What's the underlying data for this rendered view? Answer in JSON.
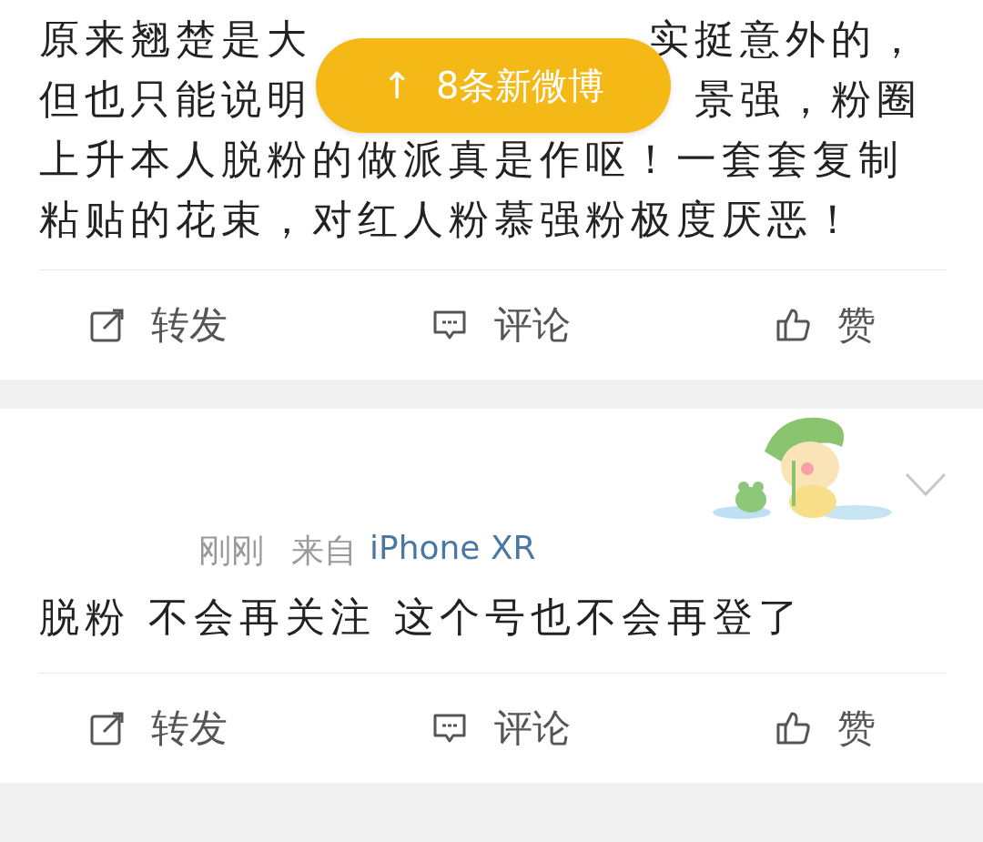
{
  "banner": {
    "icon": "↑",
    "label": "8条新微博"
  },
  "posts": [
    {
      "text_lines": [
        [
          "原来翘楚是大",
          "实挺意外的，"
        ],
        [
          "但也只能说明",
          "景强，粉圈"
        ],
        [
          "上升本人脱粉的做派真是作呕！一套套复制"
        ],
        [
          "粘贴的花束，对红人粉慕强粉极度厌恶！"
        ]
      ],
      "actions": [
        {
          "kind": "repost",
          "label": "转发"
        },
        {
          "kind": "comment",
          "label": "评论"
        },
        {
          "kind": "like",
          "label": "赞"
        }
      ]
    },
    {
      "header": {
        "time": "刚刚",
        "source_prefix": "来自",
        "source": "iPhone XR"
      },
      "text_lines": [
        [
          "脱粉 不会再关注 这个号也不会再登了"
        ]
      ],
      "actions": [
        {
          "kind": "repost",
          "label": "转发"
        },
        {
          "kind": "comment",
          "label": "评论"
        },
        {
          "kind": "like",
          "label": "赞"
        }
      ]
    }
  ]
}
